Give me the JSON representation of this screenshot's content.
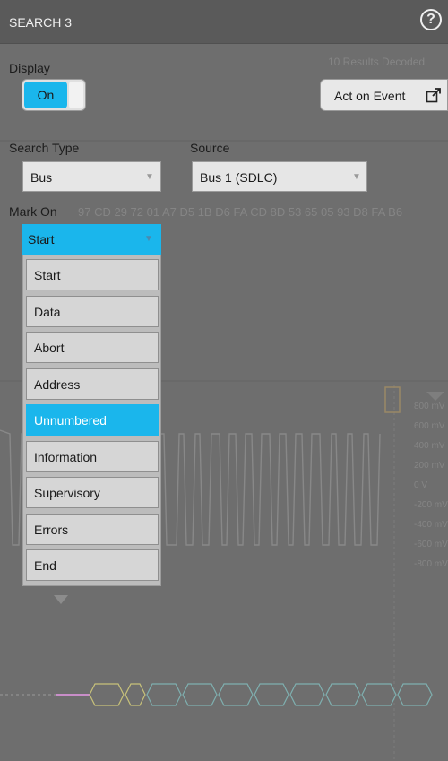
{
  "header": {
    "title": "SEARCH 3",
    "help_icon": "question-circle-icon"
  },
  "display": {
    "label": "Display",
    "toggle_label": "On"
  },
  "act_on_event": {
    "label": "Act on Event",
    "icon": "external-link-icon"
  },
  "search_type": {
    "label": "Search Type",
    "value": "Bus"
  },
  "source": {
    "label": "Source",
    "value": "Bus 1 (SDLC)"
  },
  "mark_on": {
    "label": "Mark On",
    "value": "Start",
    "options": [
      "Start",
      "Data",
      "Abort",
      "Address",
      "Unnumbered",
      "Information",
      "Supervisory",
      "Errors",
      "End"
    ],
    "highlighted": "Unnumbered"
  },
  "background": {
    "hex_text": "97 CD 29 72 01 A7 D5 1B D6 FA CD 8D 53 65 05 93 D8 FA B6",
    "top_right_text": "10 Results Decoded",
    "volt_labels": [
      "800 mV",
      "600 mV",
      "400 mV",
      "200 mV",
      "0 V",
      "-200 mV",
      "-400 mV",
      "-600 mV",
      "-800 mV"
    ]
  },
  "colors": {
    "accent": "#1ab6ec",
    "header": "#5a5a5a",
    "panel": "#6e6e6e"
  }
}
